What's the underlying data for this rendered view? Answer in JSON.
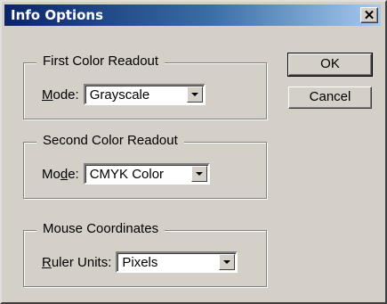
{
  "window": {
    "title": "Info Options",
    "close_glyph": "✕"
  },
  "first_readout": {
    "title": "First Color Readout",
    "mode_label": "Mode:",
    "mode_value": "Grayscale"
  },
  "second_readout": {
    "title": "Second Color Readout",
    "mode_label": "Mode:",
    "mode_value": "CMYK Color"
  },
  "mouse_coordinates": {
    "title": "Mouse Coordinates",
    "units_label": "Ruler Units:",
    "units_value": "Pixels"
  },
  "buttons": {
    "ok": "OK",
    "cancel": "Cancel"
  },
  "icons": {
    "close": "close-icon",
    "dropdown": "chevron-down-icon"
  }
}
